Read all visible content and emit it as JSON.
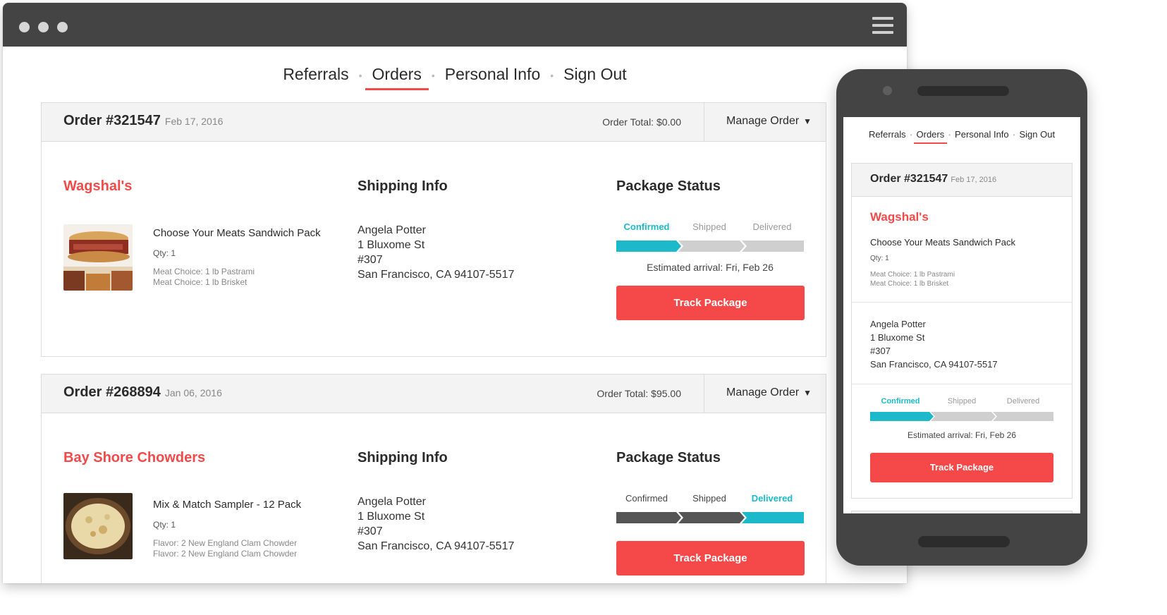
{
  "desktop": {
    "nav": [
      "Referrals",
      "Orders",
      "Personal Info",
      "Sign Out"
    ],
    "active_nav": "Orders",
    "orders": [
      {
        "order_number": "Order #321547",
        "date": "Feb 17, 2016",
        "total": "Order Total: $0.00",
        "manage_label": "Manage Order",
        "vendor": "Wagshal's",
        "shipping_heading": "Shipping Info",
        "status_heading": "Package Status",
        "product_name": "Choose Your Meats Sandwich Pack",
        "qty": "Qty: 1",
        "options": [
          "Meat Choice: 1 lb Pastrami",
          "Meat Choice: 1 lb Brisket"
        ],
        "address": [
          "Angela Potter",
          "1 Bluxome St",
          "#307",
          "San Francisco, CA 94107-5517"
        ],
        "steps": [
          "Confirmed",
          "Shipped",
          "Delivered"
        ],
        "current_step": "Confirmed",
        "eta": "Estimated arrival: Fri, Feb 26",
        "track_label": "Track Package"
      },
      {
        "order_number": "Order #268894",
        "date": "Jan 06, 2016",
        "total": "Order Total: $95.00",
        "manage_label": "Manage Order",
        "vendor": "Bay Shore Chowders",
        "shipping_heading": "Shipping Info",
        "status_heading": "Package Status",
        "product_name": "Mix & Match Sampler - 12 Pack",
        "qty": "Qty: 1",
        "options": [
          "Flavor: 2 New England Clam Chowder",
          "Flavor: 2 New England Clam Chowder"
        ],
        "address": [
          "Angela Potter",
          "1 Bluxome St",
          "#307",
          "San Francisco, CA 94107-5517"
        ],
        "steps": [
          "Confirmed",
          "Shipped",
          "Delivered"
        ],
        "current_step": "Delivered",
        "track_label": "Track Package"
      }
    ]
  },
  "mobile": {
    "nav": [
      "Referrals",
      "Orders",
      "Personal Info",
      "Sign Out"
    ],
    "active_nav": "Orders",
    "order": {
      "order_number": "Order #321547",
      "date": "Feb 17, 2016",
      "vendor": "Wagshal's",
      "product_name": "Choose Your Meats Sandwich Pack",
      "qty": "Qty: 1",
      "options": [
        "Meat Choice: 1 lb Pastrami",
        "Meat Choice: 1 lb Brisket"
      ],
      "address": [
        "Angela Potter",
        "1 Bluxome St",
        "#307",
        "San Francisco, CA 94107-5517"
      ],
      "steps": [
        "Confirmed",
        "Shipped",
        "Delivered"
      ],
      "current_step": "Confirmed",
      "eta": "Estimated arrival: Fri, Feb 26",
      "track_label": "Track Package"
    }
  },
  "colors": {
    "accent": "#f24a4a",
    "button": "#f54848",
    "progress_active": "#1bb9c9",
    "progress_inactive": "#cfcfcf",
    "progress_done": "#555555",
    "frame": "#444444"
  },
  "icons": [
    "menu-icon",
    "caret-down-icon"
  ]
}
